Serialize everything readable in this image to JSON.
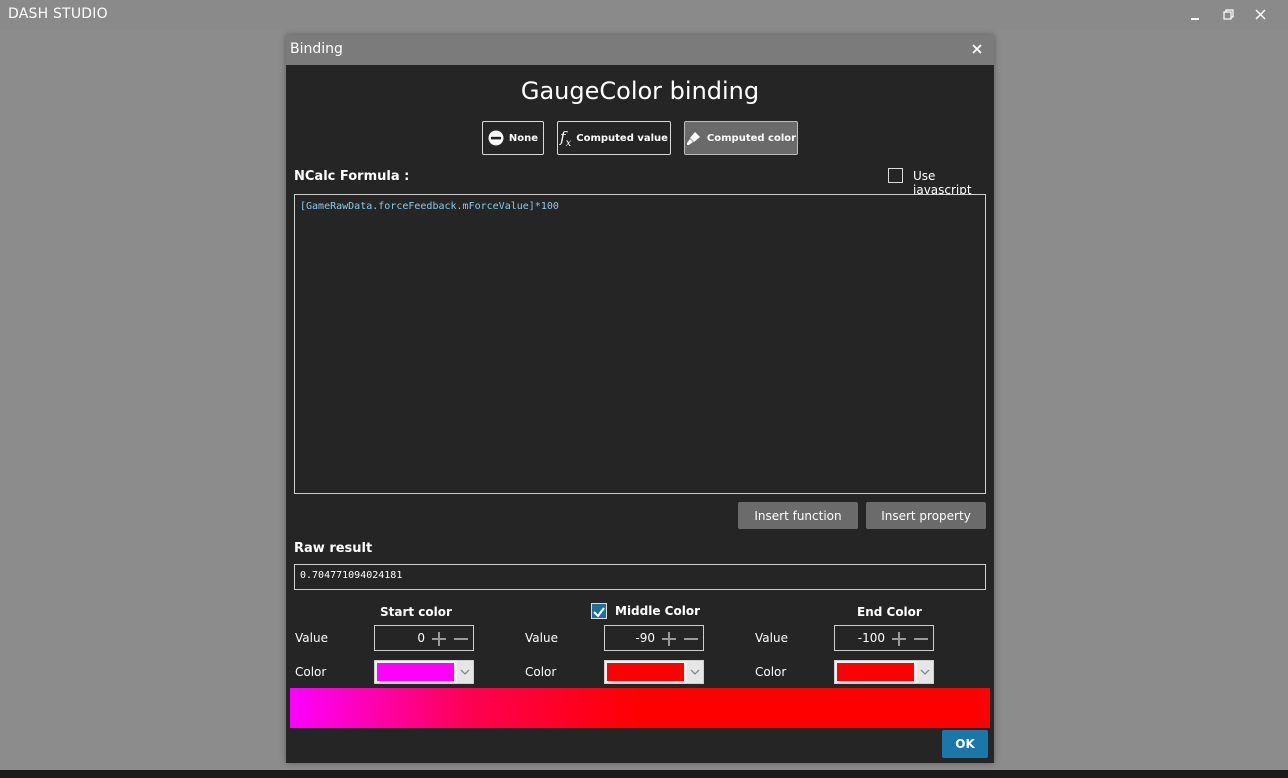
{
  "app": {
    "title": "DASH STUDIO"
  },
  "dialog": {
    "title": "Binding",
    "heading": "GaugeColor binding",
    "modes": [
      {
        "label": "None",
        "icon": "no-entry-icon",
        "active": false
      },
      {
        "label": "Computed value",
        "icon": "fx-icon",
        "active": false
      },
      {
        "label": "Computed color",
        "icon": "paint-brush-icon",
        "active": true
      }
    ],
    "formula_label": "NCalc Formula :",
    "use_javascript_label": "Use javascript",
    "use_javascript_checked": false,
    "formula": "[GameRawData.forceFeedback.mForceValue]*100",
    "insert_function_label": "Insert function",
    "insert_property_label": "Insert property",
    "raw_result_label": "Raw result",
    "raw_result_value": "0.704771094024181",
    "start": {
      "heading": "Start color",
      "value_label": "Value",
      "value": "0",
      "color_label": "Color",
      "color": "#ff00ff"
    },
    "middle": {
      "heading": "Middle Color",
      "enabled": true,
      "value_label": "Value",
      "value": "-90",
      "color_label": "Color",
      "color": "#ff0000"
    },
    "end": {
      "heading": "End Color",
      "value_label": "Value",
      "value": "-100",
      "color_label": "Color",
      "color": "#ff0000"
    },
    "ok_label": "OK"
  },
  "colors": {
    "accent": "#1a77a8",
    "formula_text": "#8ec8e6"
  }
}
